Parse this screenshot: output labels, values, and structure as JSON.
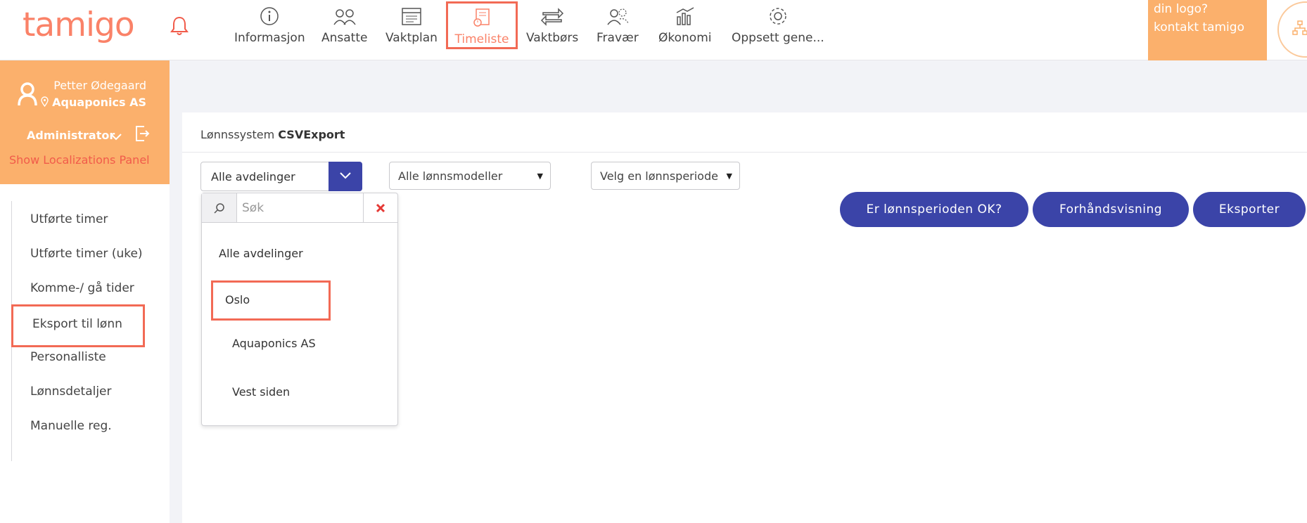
{
  "brand": {
    "logo": "tamigo",
    "accent": "#fa8268",
    "primary": "#3b44a8"
  },
  "header": {
    "notifications_icon": "bell-icon",
    "nav": [
      {
        "id": "informasjon",
        "label": "Informasjon",
        "icon": "info-icon"
      },
      {
        "id": "ansatte",
        "label": "Ansatte",
        "icon": "people-icon"
      },
      {
        "id": "vaktplan",
        "label": "Vaktplan",
        "icon": "calendar-icon"
      },
      {
        "id": "timeliste",
        "label": "Timeliste",
        "icon": "timesheet-icon",
        "active": true
      },
      {
        "id": "vaktbors",
        "label": "Vaktbørs",
        "icon": "swap-arrows-icon"
      },
      {
        "id": "fravaer",
        "label": "Fravær",
        "icon": "absence-icon"
      },
      {
        "id": "okonomi",
        "label": "Økonomi",
        "icon": "finance-icon"
      },
      {
        "id": "oppsett",
        "label": "Oppsett gene...",
        "icon": "gear-icon"
      }
    ],
    "promo_line1": "din logo?",
    "promo_line2": "kontakt tamigo",
    "org_icon": "org-chart-icon"
  },
  "profile": {
    "name": "Petter Ødegaard",
    "company": "Aquaponics AS",
    "role": "Administrator",
    "localization_link": "Show Localizations Panel"
  },
  "sidebar": {
    "items": [
      {
        "label": "Utførte timer"
      },
      {
        "label": "Utførte timer (uke)"
      },
      {
        "label": "Komme-/ gå tider"
      },
      {
        "label": "Eksport til lønn",
        "active": true
      },
      {
        "label": "Personalliste"
      },
      {
        "label": "Lønnsdetaljer"
      },
      {
        "label": "Manuelle reg."
      }
    ]
  },
  "main": {
    "breadcrumb_prefix": "Lønnssystem",
    "breadcrumb_value": "CSVExport",
    "department_select": {
      "value": "Alle avdelinger"
    },
    "salary_model_select": {
      "value": "Alle lønnsmodeller"
    },
    "period_select": {
      "value": "Velg en lønnsperiode"
    },
    "buttons": {
      "check_period": "Er lønnsperioden OK?",
      "preview": "Forhåndsvisning",
      "export": "Eksporter"
    },
    "dropdown": {
      "search_placeholder": "Søk",
      "options": [
        {
          "label": "Alle avdelinger"
        },
        {
          "label": "Oslo",
          "highlighted": true
        },
        {
          "label": "Aquaponics AS"
        },
        {
          "label": "Vest siden"
        }
      ]
    }
  }
}
